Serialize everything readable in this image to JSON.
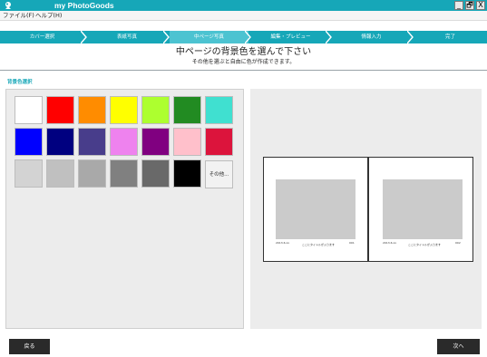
{
  "app": {
    "title": "my PhotoGoods"
  },
  "window_buttons": {
    "minimize": "_",
    "restore": "🗗",
    "close": "X"
  },
  "menu": [
    {
      "label": "ファイル(F)"
    },
    {
      "label": "ヘルプ(H)"
    }
  ],
  "steps": [
    {
      "label": "カバー選択",
      "active": false
    },
    {
      "label": "表紙写真",
      "active": false
    },
    {
      "label": "中ページ写真",
      "active": true
    },
    {
      "label": "編集・プレビュー",
      "active": false
    },
    {
      "label": "情報入力",
      "active": false
    },
    {
      "label": "完了",
      "active": false
    }
  ],
  "heading": {
    "title": "中ページの背景色を選んで下さい",
    "subtitle": "その他を選ぶと自由に色が作成できます。"
  },
  "section_label": "背景色選択",
  "palette": {
    "rows": [
      [
        "#ffffff",
        "#ff0000",
        "#ff8c00",
        "#ffff00",
        "#adff2f",
        "#228b22",
        "#40e0d0"
      ],
      [
        "#0000ff",
        "#000080",
        "#483d8b",
        "#ee82ee",
        "#800080",
        "#ffc0cb",
        "#dc143c"
      ],
      [
        "#d3d3d3",
        "#c0c0c0",
        "#a9a9a9",
        "#808080",
        "#696969",
        "#000000"
      ]
    ],
    "more_label": "その他..."
  },
  "preview": {
    "left_page": {
      "footer_left": "2013.6.xx",
      "footer_center": "ここにタイトルが入ります",
      "footer_right": "001"
    },
    "right_page": {
      "footer_left": "2013.6.xx",
      "footer_center": "ここにタイトルが入ります",
      "footer_right": "002"
    },
    "photo_color": "#cbcbcb"
  },
  "buttons": {
    "back": "戻る",
    "next": "次へ"
  },
  "colors": {
    "accent": "#16a7b8",
    "active_step": "#4cc3d1",
    "button_dark": "#2a2a2a"
  }
}
